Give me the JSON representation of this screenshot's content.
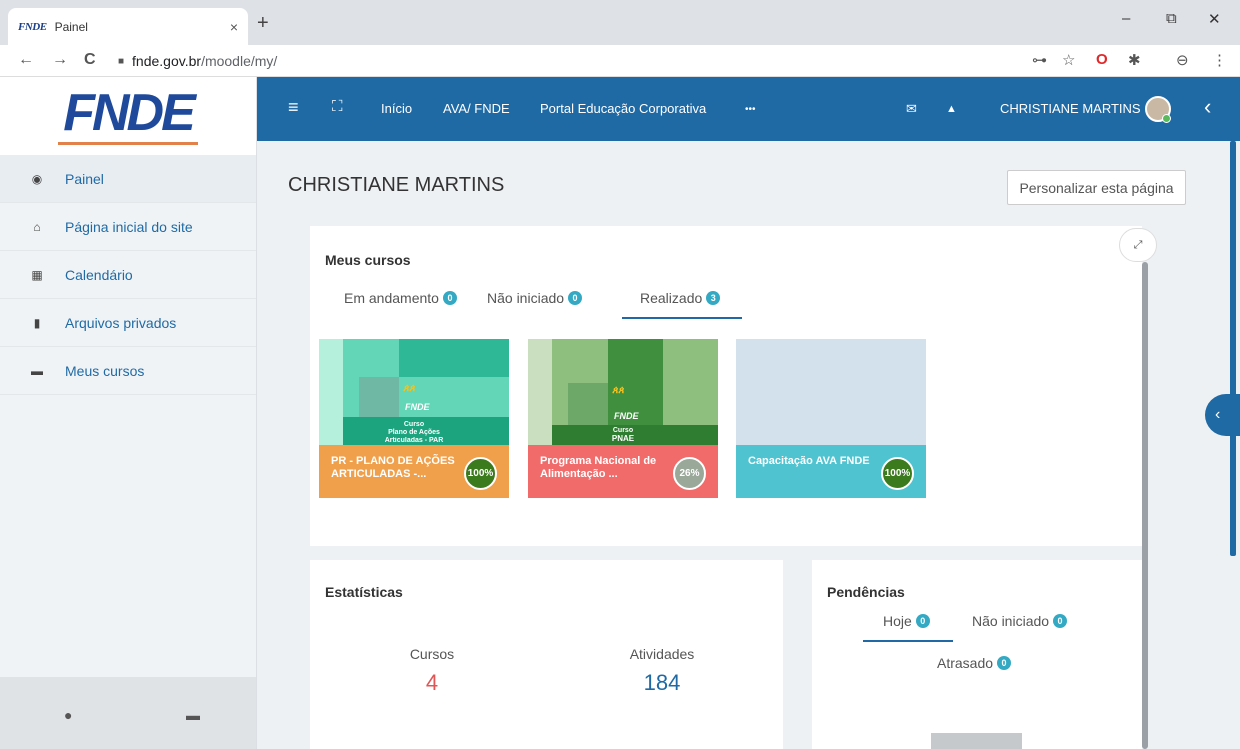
{
  "browser": {
    "tab_favicon": "FNDE",
    "tab_title": "Painel",
    "tab_close": "×",
    "new_tab": "+",
    "win_min": "–",
    "win_max": "⧉",
    "win_close": "✕",
    "back": "←",
    "forward": "→",
    "reload": "C",
    "url_host": "fnde.gov.br",
    "url_path": "/moodle/my/",
    "ext_key": "⊶",
    "ext_star": "☆",
    "ext_opera": "O",
    "ext_puzzle": "✱",
    "ext_profile": "⊖",
    "ext_menu": "⋮"
  },
  "sidebar": {
    "logo": "FNDE",
    "items": [
      {
        "label": "Painel",
        "icon": "dashboard-icon",
        "glyph": "◉"
      },
      {
        "label": "Página inicial do site",
        "icon": "home-icon",
        "glyph": "⌂"
      },
      {
        "label": "Calendário",
        "icon": "calendar-icon",
        "glyph": "▦"
      },
      {
        "label": "Arquivos privados",
        "icon": "files-icon",
        "glyph": "▮"
      },
      {
        "label": "Meus cursos",
        "icon": "archive-icon",
        "glyph": "▬"
      }
    ],
    "footer_chat_glyph": "●",
    "footer_archive_glyph": "▬"
  },
  "navbar": {
    "menu_glyph": "≡",
    "fullscreen_glyph": "⛶",
    "links": [
      "Início",
      "AVA/ FNDE",
      "Portal Educação Corporativa",
      "•••"
    ],
    "mail_glyph": "✉",
    "bell_glyph": "▲",
    "user_name": "CHRISTIANE MARTINS",
    "collapse_glyph": "‹"
  },
  "main": {
    "title": "CHRISTIANE MARTINS",
    "customize_button": "Personalizar esta página",
    "expand_glyph": "⤢",
    "drawer_glyph": "‹"
  },
  "my_courses": {
    "title": "Meus cursos",
    "tabs": [
      {
        "label": "Em andamento",
        "count": "0"
      },
      {
        "label": "Não iniciado",
        "count": "0"
      },
      {
        "label": "Realizado",
        "count": "3"
      }
    ],
    "active_tab": "Realizado",
    "courses": [
      {
        "name": "PR - PLANO DE AÇÕES ARTICULADAS -...",
        "progress": "100%",
        "thumb_logo": "FNDE",
        "thumb_line1": "Curso",
        "thumb_line2": "Plano de Ações",
        "thumb_line3": "Articuladas - PAR"
      },
      {
        "name": "Programa Nacional de Alimentação ...",
        "progress": "26%",
        "thumb_logo": "FNDE",
        "thumb_line1": "Curso",
        "thumb_line2": "PNAE"
      },
      {
        "name": "Capacitação AVA FNDE",
        "progress": "100%"
      }
    ]
  },
  "stats": {
    "title": "Estatísticas",
    "courses_label": "Cursos",
    "courses_value": "4",
    "activities_label": "Atividades",
    "activities_value": "184"
  },
  "pending": {
    "title": "Pendências",
    "tabs": [
      {
        "label": "Hoje",
        "count": "0"
      },
      {
        "label": "Não iniciado",
        "count": "0"
      },
      {
        "label": "Atrasado",
        "count": "0"
      }
    ]
  },
  "colors": {
    "brand": "#1f6aa5",
    "course1_band": "#f0a04b",
    "course2_band": "#f26b6b",
    "course3_band": "#4fc3d0",
    "stat_courses": "#e05555",
    "stat_activities": "#1f6aa5"
  }
}
